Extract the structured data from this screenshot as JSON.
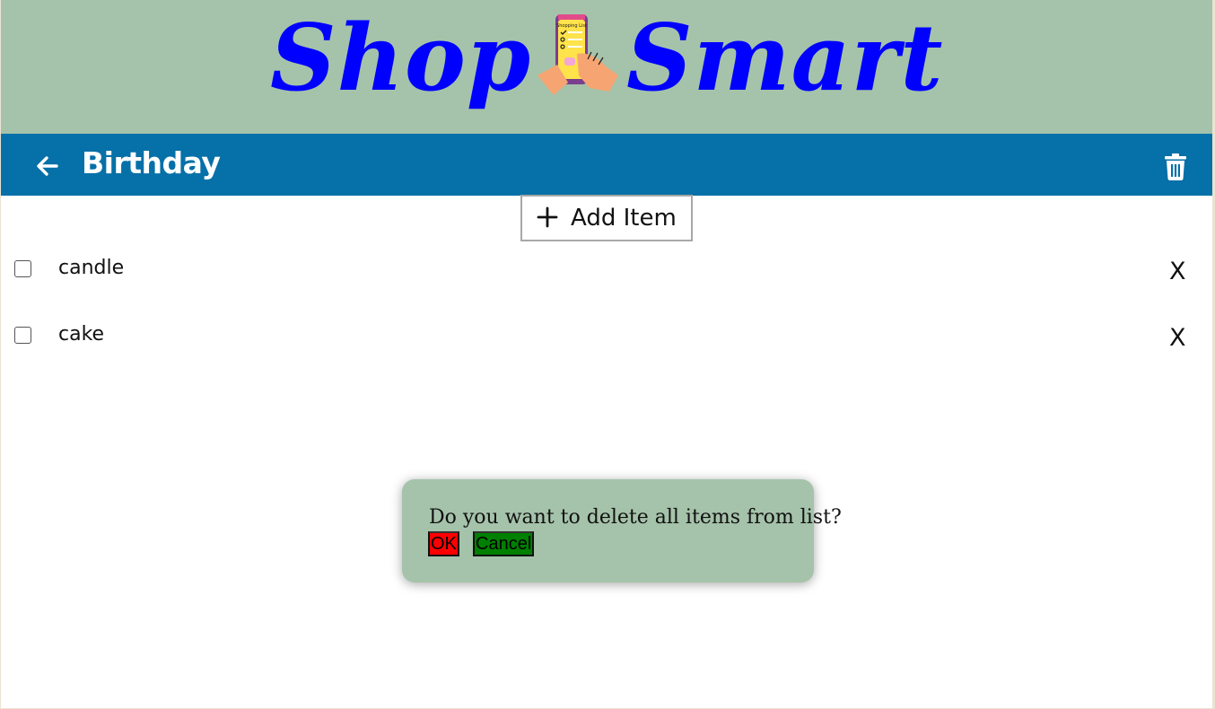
{
  "brand": {
    "word_left": "Shop",
    "word_right": "Smart",
    "logo_icon": "shopping-list-phone-icon",
    "logo_caption": "Shopping List",
    "color": "#0000ff",
    "background": "#a5c3aa"
  },
  "toolbar": {
    "back_icon": "arrow-left-icon",
    "title": "Birthday",
    "delete_icon": "trash-icon",
    "background": "#0670a8"
  },
  "add_item": {
    "icon": "plus-icon",
    "label": "Add Item"
  },
  "items": [
    {
      "name": "candle",
      "checked": false,
      "delete_label": "X"
    },
    {
      "name": "cake",
      "checked": false,
      "delete_label": "X"
    }
  ],
  "dialog": {
    "message": "Do you want to delete all items from list?",
    "ok_label": "OK",
    "cancel_label": "Cancel",
    "ok_color": "#ff0000",
    "cancel_color": "#008000"
  }
}
